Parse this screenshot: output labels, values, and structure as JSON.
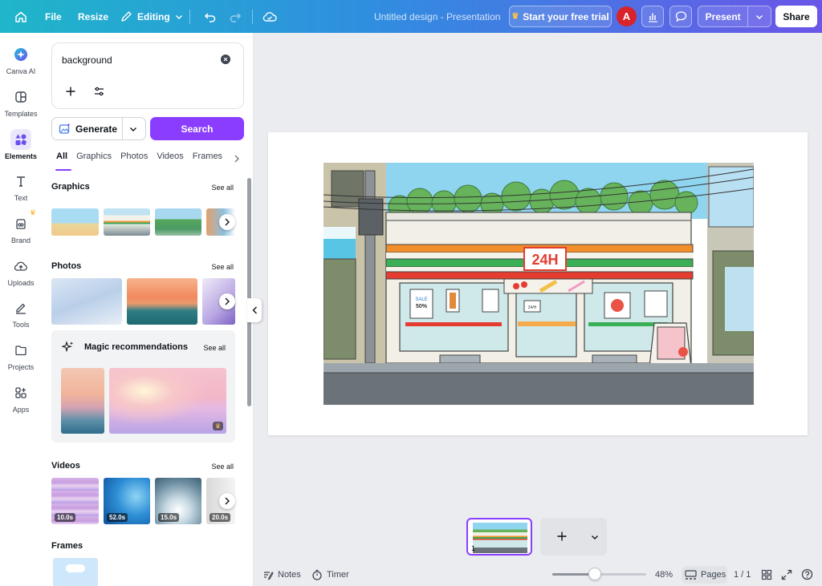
{
  "topbar": {
    "file_label": "File",
    "resize_label": "Resize",
    "editing_label": "Editing",
    "design_title": "Untitled design - Presentation",
    "trial_label": "Start your free trial",
    "avatar_initial": "A",
    "present_label": "Present",
    "share_label": "Share"
  },
  "rail": {
    "items": [
      {
        "label": "Canva AI",
        "icon": "canva-ai-icon"
      },
      {
        "label": "Templates",
        "icon": "templates-icon"
      },
      {
        "label": "Elements",
        "icon": "elements-icon",
        "active": true
      },
      {
        "label": "Text",
        "icon": "text-icon"
      },
      {
        "label": "Brand",
        "icon": "brand-icon"
      },
      {
        "label": "Uploads",
        "icon": "uploads-icon"
      },
      {
        "label": "Tools",
        "icon": "tools-icon"
      },
      {
        "label": "Projects",
        "icon": "projects-icon"
      },
      {
        "label": "Apps",
        "icon": "apps-icon"
      }
    ]
  },
  "panel": {
    "search_value": "background",
    "generate_label": "Generate",
    "search_label": "Search",
    "tabs": [
      "All",
      "Graphics",
      "Photos",
      "Videos",
      "Frames"
    ],
    "graphics": {
      "title": "Graphics",
      "see_all": "See all"
    },
    "photos": {
      "title": "Photos",
      "see_all": "See all"
    },
    "magic": {
      "title": "Magic recommendations",
      "see_all": "See all"
    },
    "videos": {
      "title": "Videos",
      "see_all": "See all",
      "durations": [
        "10.0s",
        "52.0s",
        "15.0s",
        "20.0s"
      ]
    },
    "frames": {
      "title": "Frames"
    }
  },
  "canvas": {
    "sign_text": "24H",
    "poster_sale": "SALE",
    "poster_discount": "50%",
    "door_sign": "24/H"
  },
  "pages_strip": {
    "page_number": "1"
  },
  "bottombar": {
    "notes_label": "Notes",
    "timer_label": "Timer",
    "zoom_level": "48%",
    "zoom_fraction": 0.45,
    "pages_label": "Pages",
    "page_count": "1 / 1"
  },
  "colors": {
    "accent": "#8b3dff",
    "topbar_start": "#1fb6c9",
    "topbar_end": "#6a56e8"
  }
}
